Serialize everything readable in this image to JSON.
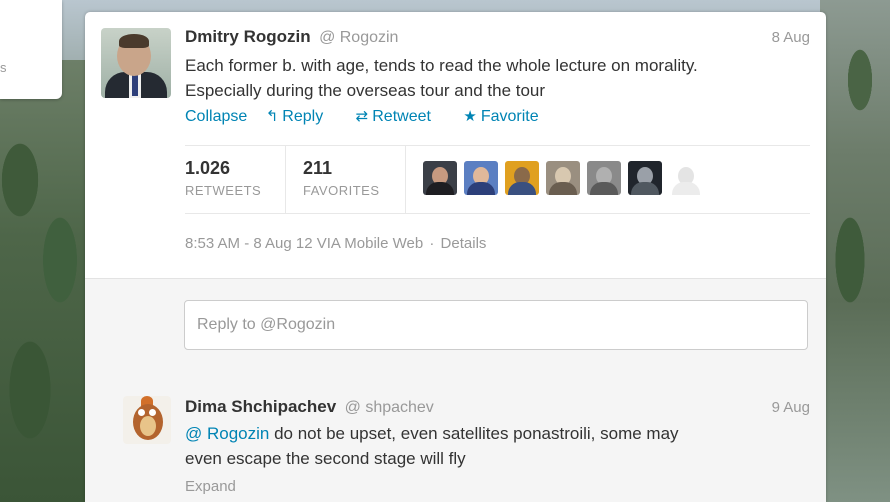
{
  "left_card": {
    "text": "s"
  },
  "tweet": {
    "author_name": "Dmitry Rogozin",
    "author_handle": "@ Rogozin",
    "date": "8 Aug",
    "text_line1": "Each former b. with age, tends to read the whole lecture on morality.",
    "text_line2": "Especially during the overseas tour and the tour",
    "actions": {
      "collapse": "Collapse",
      "reply": "Reply",
      "retweet": "Retweet",
      "favorite": "Favorite",
      "reply_icon": "reply-arrow-icon",
      "retweet_icon": "retweet-icon",
      "favorite_icon": "star-icon"
    },
    "stats": {
      "retweets_count": "1.026",
      "retweets_label": "RETWEETS",
      "favorites_count": "211",
      "favorites_label": "FAVORITES"
    },
    "meta": {
      "time": "8:53 AM - 8 Aug 12 VIA Mobile Web",
      "separator": "·",
      "details": "Details"
    }
  },
  "reply_box": {
    "placeholder": "Reply to @Rogozin"
  },
  "reply": {
    "author_name": "Dima Shchipachev",
    "author_handle": "@ shpachev",
    "date": "9 Aug",
    "mention": "@ Rogozin",
    "text_rest": " do not be upset, even satellites ponastroili, some may",
    "text_line2": "even escape the second stage will fly",
    "expand": "Expand"
  },
  "colors": {
    "link": "#0084b4",
    "muted": "#999999",
    "text": "#333333"
  }
}
